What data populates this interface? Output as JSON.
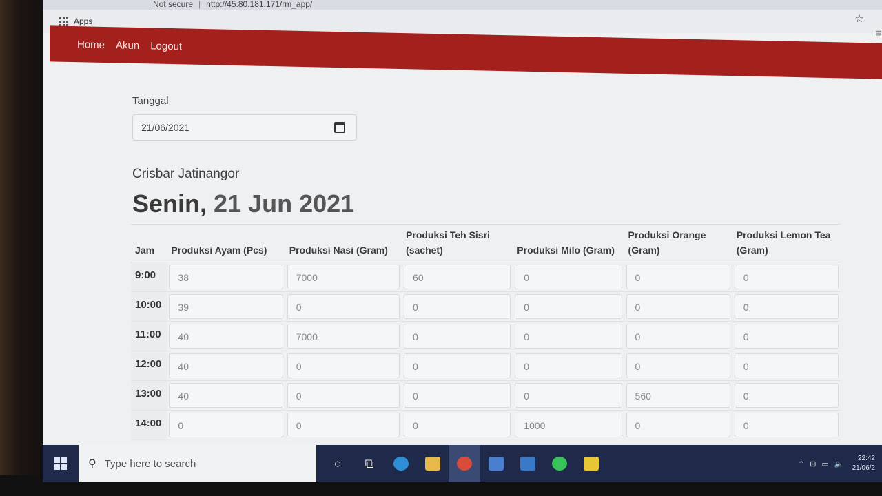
{
  "browser": {
    "security": "Not secure",
    "url": "http://45.80.181.171/rm_app/",
    "bookmark_apps": "Apps"
  },
  "nav": {
    "items": [
      "Home",
      "Akun",
      "Logout"
    ]
  },
  "form": {
    "date_label": "Tanggal",
    "date_value": "21/06/2021"
  },
  "store_name": "Crisbar Jatinangor",
  "heading": {
    "day": "Senin,",
    "date": "21 Jun 2021"
  },
  "table": {
    "headers": [
      "Jam",
      "Produksi Ayam (Pcs)",
      "Produksi Nasi (Gram)",
      "Produksi Teh Sisri (sachet)",
      "Produksi Milo (Gram)",
      "Produksi Orange (Gram)",
      "Produksi Lemon Tea (Gram)"
    ],
    "rows": [
      {
        "jam": "9:00",
        "values": [
          "38",
          "7000",
          "60",
          "0",
          "0",
          "0"
        ]
      },
      {
        "jam": "10:00",
        "values": [
          "39",
          "0",
          "0",
          "0",
          "0",
          "0"
        ]
      },
      {
        "jam": "11:00",
        "values": [
          "40",
          "7000",
          "0",
          "0",
          "0",
          "0"
        ]
      },
      {
        "jam": "12:00",
        "values": [
          "40",
          "0",
          "0",
          "0",
          "0",
          "0"
        ]
      },
      {
        "jam": "13:00",
        "values": [
          "40",
          "0",
          "0",
          "0",
          "560",
          "0"
        ]
      },
      {
        "jam": "14:00",
        "values": [
          "0",
          "0",
          "0",
          "1000",
          "0",
          "0"
        ]
      }
    ]
  },
  "taskbar": {
    "search_placeholder": "Type here to search",
    "time": "22:42",
    "date": "21/06/2"
  }
}
